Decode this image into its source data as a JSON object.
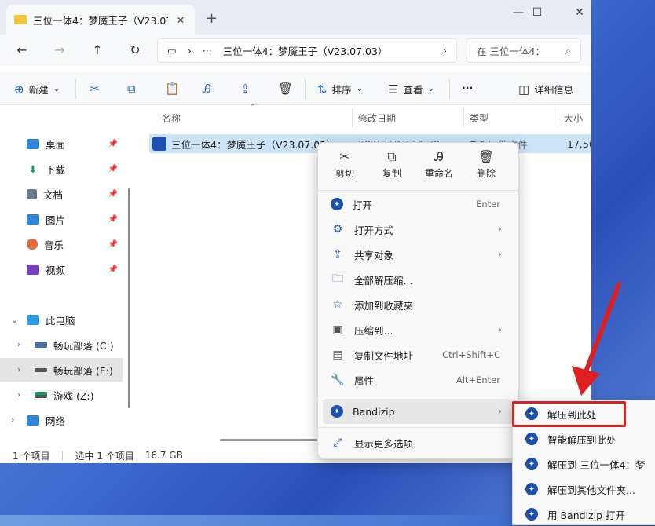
{
  "window": {
    "tab_title": "三位一体4：梦魇王子（V23.07",
    "address": "三位一体4：梦魇王子（V23.07.03）",
    "search_placeholder": "在 三位一体4：",
    "more": "···"
  },
  "toolbar": {
    "new_label": "新建",
    "sort_label": "排序",
    "view_label": "查看",
    "more": "···",
    "details_label": "详细信息"
  },
  "sidebar": {
    "quick": [
      {
        "label": "桌面",
        "color": "#2f86d8"
      },
      {
        "label": "下载",
        "color": "#1a9c5a"
      },
      {
        "label": "文档",
        "color": "#6b7b8d"
      },
      {
        "label": "图片",
        "color": "#2f86d8"
      },
      {
        "label": "音乐",
        "color": "#e06a3a"
      },
      {
        "label": "视频",
        "color": "#7a3fc0"
      }
    ],
    "this_pc": "此电脑",
    "drives": [
      {
        "label": "畅玩部落 (C:)"
      },
      {
        "label": "畅玩部落 (E:)"
      },
      {
        "label": "游戏 (Z:)"
      }
    ],
    "network": "网络"
  },
  "columns": {
    "name": "名称",
    "modified": "修改日期",
    "type": "类型",
    "size": "大小"
  },
  "file": {
    "name": "三位一体4：梦魇王子（V23.07.03）",
    "modified": "2025/7/12 11:30",
    "type": "ZIP 压缩文件",
    "size": "17,56"
  },
  "status": {
    "items": "1 个项目",
    "selected": "选中 1 个项目",
    "size": "16.7 GB"
  },
  "context_menu": {
    "quick_actions": [
      "剪切",
      "复制",
      "重命名",
      "删除"
    ],
    "items": [
      {
        "label": "打开",
        "accel": "Enter"
      },
      {
        "label": "打开方式",
        "arrow": "›"
      },
      {
        "label": "共享对象",
        "arrow": "›"
      },
      {
        "label": "全部解压缩..."
      },
      {
        "label": "添加到收藏夹"
      },
      {
        "label": "压缩到...",
        "arrow": "›"
      },
      {
        "label": "复制文件地址",
        "accel": "Ctrl+Shift+C"
      },
      {
        "label": "属性",
        "accel": "Alt+Enter"
      },
      {
        "label": "Bandizip",
        "arrow": "›"
      },
      {
        "label": "显示更多选项"
      }
    ]
  },
  "submenu": {
    "items": [
      "解压到此处",
      "智能解压到此处",
      "解压到 三位一体4：梦",
      "解压到其他文件夹...",
      "用 Bandizip 打开"
    ]
  },
  "colors": {
    "accent": "#1f5fbf",
    "highlight": "#e02020",
    "selection": "#cce4f7"
  }
}
